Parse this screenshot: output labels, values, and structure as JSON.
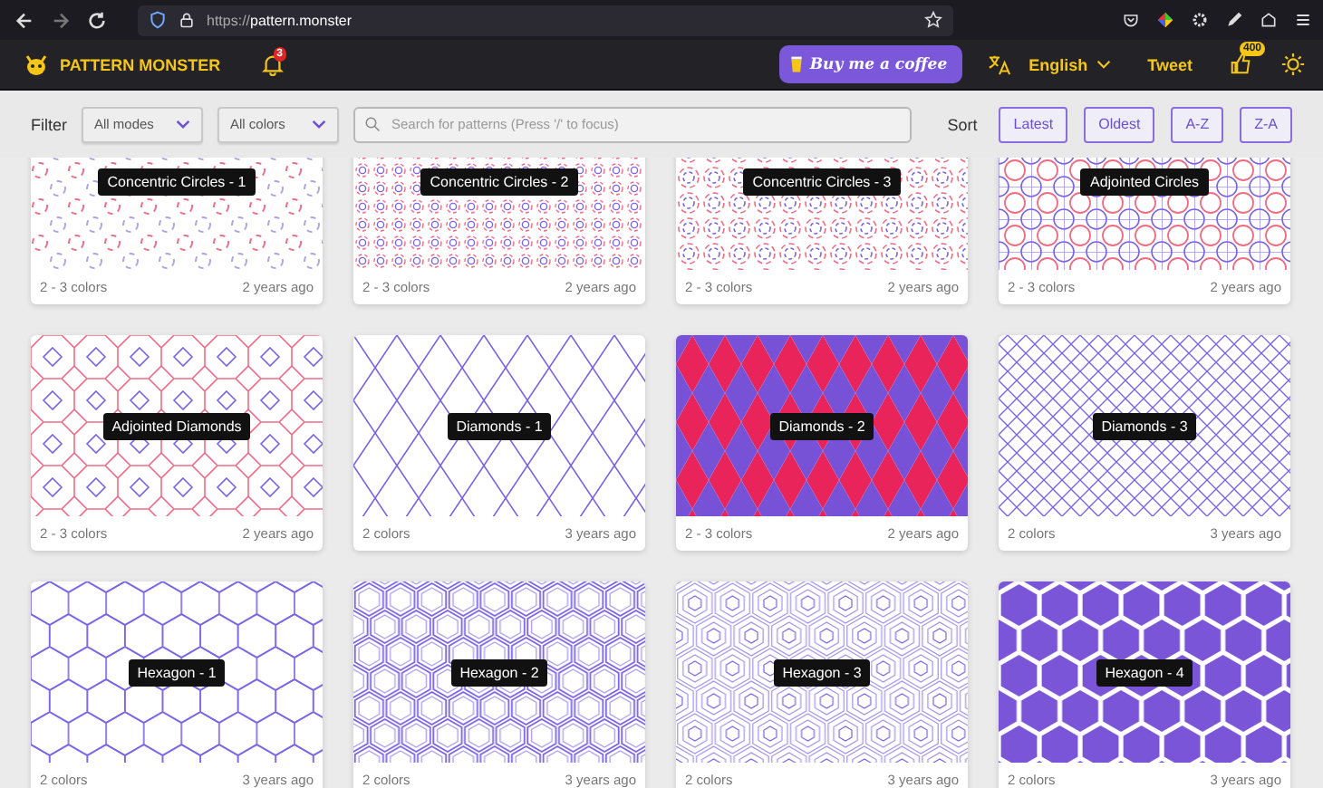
{
  "browser": {
    "url_scheme": "https://",
    "url_host": "pattern.monster"
  },
  "header": {
    "brand": "PATTERN MONSTER",
    "notifications": "3",
    "coffee_button": "Buy me a coffee",
    "language": "English",
    "tweet": "Tweet",
    "likes": "400"
  },
  "filter": {
    "label": "Filter",
    "modes": "All modes",
    "colors": "All colors",
    "search_placeholder": "Search for patterns (Press '/' to focus)",
    "sort_label": "Sort",
    "sort_buttons": [
      "Latest",
      "Oldest",
      "A-Z",
      "Z-A"
    ]
  },
  "cards": [
    {
      "title": "Concentric Circles - 1",
      "colors": "2 - 3 colors",
      "age": "2 years ago",
      "kind": "circles-sparse"
    },
    {
      "title": "Concentric Circles - 2",
      "colors": "2 - 3 colors",
      "age": "2 years ago",
      "kind": "circles-dense"
    },
    {
      "title": "Concentric Circles - 3",
      "colors": "2 - 3 colors",
      "age": "2 years ago",
      "kind": "circles-nested"
    },
    {
      "title": "Adjointed Circles",
      "colors": "2 - 3 colors",
      "age": "2 years ago",
      "kind": "adjointed-circles"
    },
    {
      "title": "Adjointed Diamonds",
      "colors": "2 - 3 colors",
      "age": "2 years ago",
      "kind": "adjointed-diamonds"
    },
    {
      "title": "Diamonds - 1",
      "colors": "2 colors",
      "age": "3 years ago",
      "kind": "lattice"
    },
    {
      "title": "Diamonds - 2",
      "colors": "2 - 3 colors",
      "age": "2 years ago",
      "kind": "harlequin"
    },
    {
      "title": "Diamonds - 3",
      "colors": "2 colors",
      "age": "3 years ago",
      "kind": "fine-lattice"
    },
    {
      "title": "Hexagon - 1",
      "colors": "2 colors",
      "age": "3 years ago",
      "kind": "hex-outline"
    },
    {
      "title": "Hexagon - 2",
      "colors": "2 colors",
      "age": "3 years ago",
      "kind": "hex-double"
    },
    {
      "title": "Hexagon - 3",
      "colors": "2 colors",
      "age": "3 years ago",
      "kind": "hex-rings"
    },
    {
      "title": "Hexagon - 4",
      "colors": "2 colors",
      "age": "3 years ago",
      "kind": "hex-filled"
    }
  ]
}
